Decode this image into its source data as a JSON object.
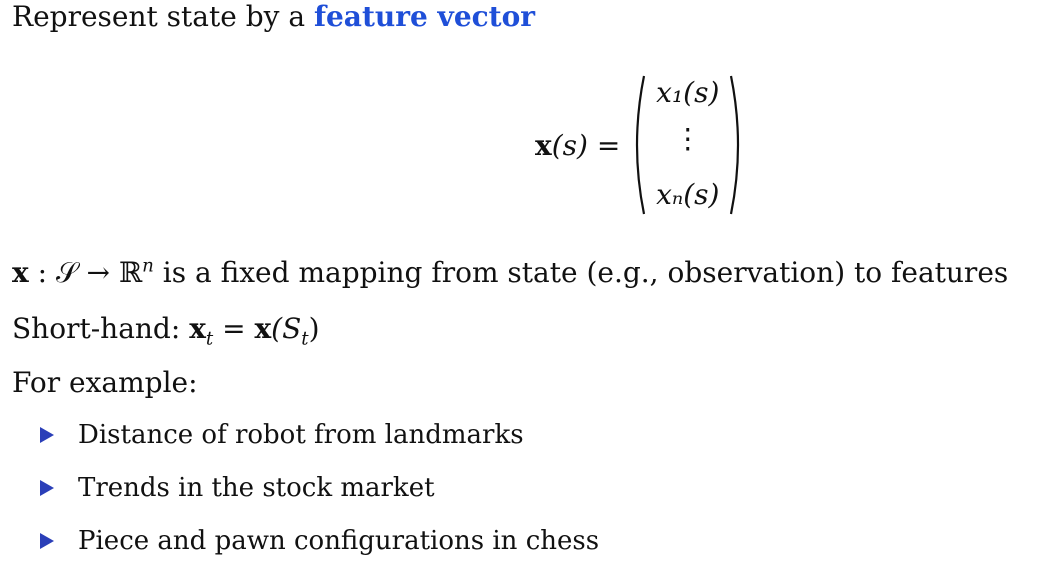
{
  "heading": {
    "prefix": "Represent state by a ",
    "highlight": "feature vector"
  },
  "equation": {
    "lhs_symbol": "x",
    "lhs_arg": "(s) =",
    "entry_top": "x₁(s)",
    "entry_middle": "⋮",
    "entry_bottom": "xₙ(s)"
  },
  "mapping": {
    "symbol": "x",
    "math": " : 𝒮 → ℝ",
    "power": "n",
    "text": " is a fixed mapping from state (e.g., observation) to features"
  },
  "shorthand": {
    "label": "Short-hand: ",
    "lhs": "x",
    "lhs_sub": "t",
    "eq": " = ",
    "rhs": "x",
    "rhs_arg_open": "(S",
    "rhs_sub": "t",
    "rhs_arg_close": ")"
  },
  "example_label": "For example:",
  "examples": [
    "Distance of robot from landmarks",
    "Trends in the stock market",
    "Piece and pawn configurations in chess"
  ],
  "colors": {
    "accent": "#1f4fd8",
    "bullet": "#2b3fb8",
    "text": "#111111"
  },
  "icons": {
    "bullet": "triangle-right-icon"
  }
}
